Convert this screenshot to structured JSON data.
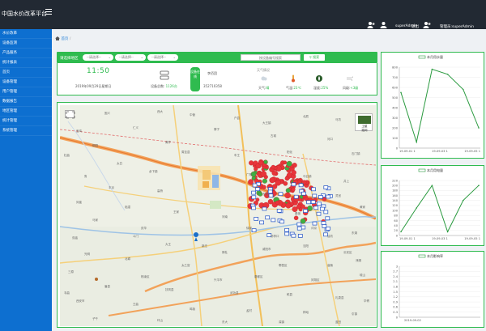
{
  "app": {
    "title": "中国水价改革平台"
  },
  "header": {
    "user_name": "superAdmin",
    "logout_label": "退出",
    "admin_label": "管理员:superAdmin"
  },
  "sidebar": {
    "items": [
      {
        "label": "水价改革"
      },
      {
        "label": "设备监测"
      },
      {
        "label": "产品服务"
      },
      {
        "label": "统计报表"
      },
      {
        "label": "首页"
      },
      {
        "label": "设备管理"
      },
      {
        "label": "用户管理"
      },
      {
        "label": "数据报告"
      },
      {
        "label": "地区管理"
      },
      {
        "label": "统计管理"
      },
      {
        "label": "系统管理"
      }
    ]
  },
  "breadcrumb": {
    "home": "首页"
  },
  "filter": {
    "label": "请选择地区",
    "selects": [
      "--请选择--",
      "--请选择--",
      "--请选择--"
    ],
    "search_placeholder": "按设备编号搜索",
    "search_button": "搜索"
  },
  "info": {
    "clock": "11:50",
    "date": "2019年09月29日星期日",
    "device_label": "设备总数:",
    "device_count": "1126台",
    "online_badge": "设备在线",
    "station_name": "李佰团",
    "station_code": "352710358",
    "weather_title": "天气情况",
    "weather": [
      {
        "label": "天气:",
        "value": "晴"
      },
      {
        "label": "气温:",
        "value": "23℃"
      },
      {
        "label": "湿度:",
        "value": "25%"
      },
      {
        "label": "风级:",
        "value": "<3级"
      }
    ]
  },
  "map": {
    "satellite_label": "卫星",
    "satellite_sub": "路网",
    "labels": [
      "固义",
      "西大",
      "中营",
      "户县",
      "大王镇",
      "北辰",
      "马坊",
      "宝鸡",
      "仁义",
      "寨子",
      "古城",
      "河口",
      "柳园",
      "黄芹",
      "周至县",
      "车王",
      "阳化",
      "石门镇",
      "太白",
      "余下镇",
      "鲁",
      "广阳",
      "马召镇",
      "井上",
      "丰京",
      "高桥",
      "东尧",
      "灵官",
      "凤凰",
      "临潼",
      "王家",
      "河南",
      "秦渡",
      "黄家",
      "马家",
      "庆华",
      "徐家",
      "沣京",
      "东湖",
      "双庙",
      "大王",
      "新庄",
      "郭杜",
      "咸阳市",
      "泾阳",
      "长安区",
      "光明",
      "北塬",
      "太乙宫",
      "鄠邑区",
      "高陵",
      "三原",
      "杨凌区",
      "兴平市",
      "秦都区",
      "凤翔区",
      "岐山",
      "眉县",
      "扶风县",
      "武功县",
      "乾县",
      "礼泉县",
      "西安市",
      "王曲",
      "鸣犊",
      "孟村",
      "祥峪",
      "引镇",
      "子午",
      "环山",
      "东大",
      "滦镇",
      "蓝田",
      "华胥",
      "洩湖",
      "油坊",
      "桥梓口",
      "斗门",
      "杜曲",
      "韦曲"
    ]
  },
  "charts": [
    {
      "title": "本月用水量",
      "chart_data": {
        "type": "line",
        "x": [
          "19-09-01 1",
          "19-09-03 1",
          "19-09-05 1"
        ],
        "ylim": [
          0,
          800
        ],
        "yticks": [
          0,
          100,
          200,
          300,
          400,
          500,
          600,
          700,
          800
        ],
        "values": [
          550,
          60,
          780,
          730,
          580,
          200
        ],
        "color": "#2a9a3f"
      }
    },
    {
      "title": "本月用电量",
      "chart_data": {
        "type": "line",
        "x": [
          "19-09-01 1",
          "19-09-03 1",
          "19-09-05 1"
        ],
        "ylim": [
          0,
          220
        ],
        "yticks": [
          0,
          20,
          40,
          60,
          80,
          100,
          120,
          140,
          160,
          180,
          200,
          220
        ],
        "values": [
          15,
          110,
          200,
          15,
          140,
          200
        ],
        "color": "#2a9a3f"
      }
    },
    {
      "title": "本月影响率",
      "chart_data": {
        "type": "line",
        "x": [
          "2019-09-02"
        ],
        "ylim": [
          0,
          3
        ],
        "yticks": [
          0,
          0.3,
          0.6,
          0.9,
          1.2,
          1.5,
          1.8,
          2.1,
          2.4,
          2.7,
          3
        ],
        "values": [],
        "color": "#2a9a3f"
      }
    }
  ],
  "colors": {
    "green": "#2fbb4f",
    "blue": "#0d6fd0",
    "dark": "#222933"
  }
}
